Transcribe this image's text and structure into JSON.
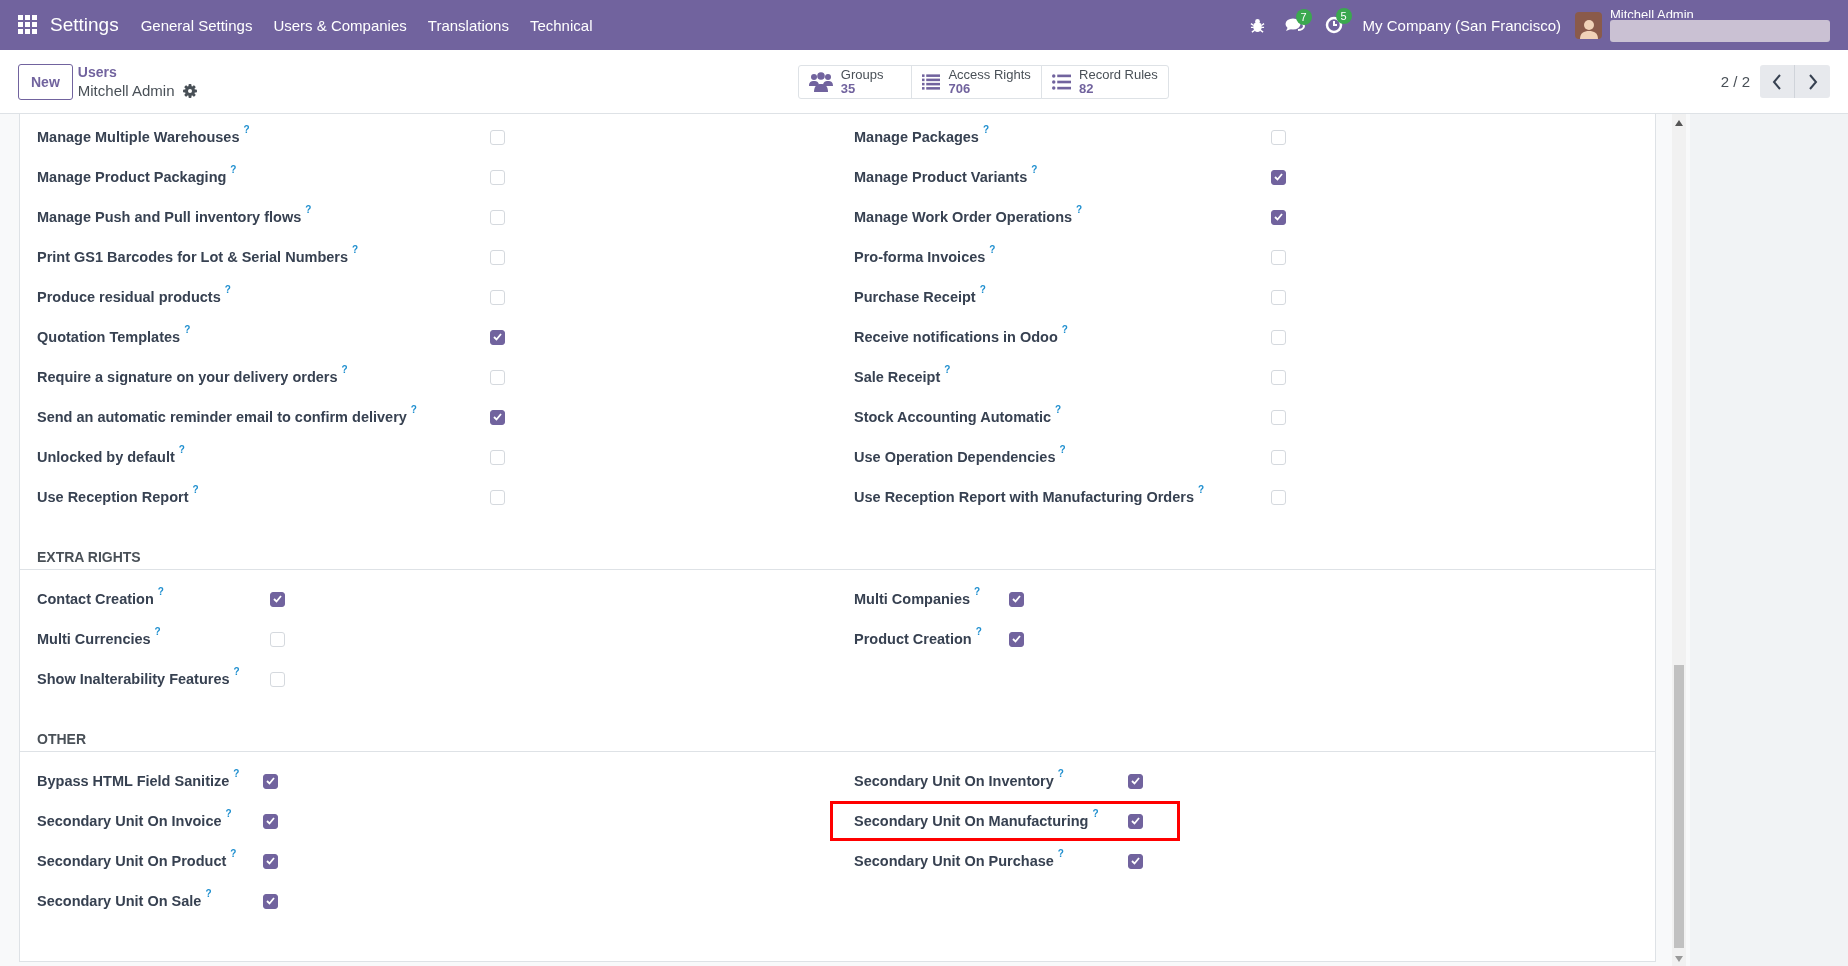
{
  "navbar": {
    "app_name": "Settings",
    "menu": [
      "General Settings",
      "Users & Companies",
      "Translations",
      "Technical"
    ],
    "messages_badge": "7",
    "activities_badge": "5",
    "company": "My Company (San Francisco)",
    "user_name": "Mitchell Admin"
  },
  "control_panel": {
    "new_button": "New",
    "breadcrumb": "Users",
    "record_title": "Mitchell Admin",
    "stat_buttons": [
      {
        "kind": "groups",
        "label": "Groups",
        "count": "35"
      },
      {
        "kind": "access",
        "label": "Access Rights",
        "count": "706"
      },
      {
        "kind": "rules",
        "label": "Record Rules",
        "count": "82"
      }
    ],
    "pager": "2 / 2"
  },
  "sections": [
    {
      "left": [
        {
          "label": "Manage Multiple Warehouses",
          "help": "?",
          "checked": false,
          "highlighted": false
        },
        {
          "label": "Manage Product Packaging",
          "help": "?",
          "checked": false,
          "highlighted": false
        },
        {
          "label": "Manage Push and Pull inventory flows",
          "help": "?",
          "checked": false,
          "highlighted": false
        },
        {
          "label": "Print GS1 Barcodes for Lot & Serial Numbers",
          "help": "?",
          "checked": false,
          "highlighted": false
        },
        {
          "label": "Produce residual products",
          "help": "?",
          "checked": false,
          "highlighted": false
        },
        {
          "label": "Quotation Templates",
          "help": "?",
          "checked": true,
          "highlighted": false
        },
        {
          "label": "Require a signature on your delivery orders",
          "help": "?",
          "checked": false,
          "highlighted": false
        },
        {
          "label": "Send an automatic reminder email to confirm delivery",
          "help": "?",
          "checked": true,
          "highlighted": false
        },
        {
          "label": "Unlocked by default",
          "help": "?",
          "checked": false,
          "highlighted": false
        },
        {
          "label": "Use Reception Report",
          "help": "?",
          "checked": false,
          "highlighted": false
        }
      ],
      "right": [
        {
          "label": "Manage Packages",
          "help": "?",
          "checked": false,
          "highlighted": false
        },
        {
          "label": "Manage Product Variants",
          "help": "?",
          "checked": true,
          "highlighted": false
        },
        {
          "label": "Manage Work Order Operations",
          "help": "?",
          "checked": true,
          "highlighted": false
        },
        {
          "label": "Pro-forma Invoices",
          "help": "?",
          "checked": false,
          "highlighted": false
        },
        {
          "label": "Purchase Receipt",
          "help": "?",
          "checked": false,
          "highlighted": false
        },
        {
          "label": "Receive notifications in Odoo",
          "help": "?",
          "checked": false,
          "highlighted": false
        },
        {
          "label": "Sale Receipt",
          "help": "?",
          "checked": false,
          "highlighted": false
        },
        {
          "label": "Stock Accounting Automatic",
          "help": "?",
          "checked": false,
          "highlighted": false
        },
        {
          "label": "Use Operation Dependencies",
          "help": "?",
          "checked": false,
          "highlighted": false
        },
        {
          "label": "Use Reception Report with Manufacturing Orders",
          "help": "?",
          "checked": false,
          "highlighted": false
        }
      ]
    },
    {
      "title": "EXTRA RIGHTS",
      "left": [
        {
          "label": "Contact Creation",
          "help": "?",
          "checked": true,
          "highlighted": false
        },
        {
          "label": "Multi Currencies",
          "help": "?",
          "checked": false,
          "highlighted": false
        },
        {
          "label": "Show Inalterability Features",
          "help": "?",
          "checked": false,
          "highlighted": false
        }
      ],
      "right": [
        {
          "label": "Multi Companies",
          "help": "?",
          "checked": true,
          "highlighted": false
        },
        {
          "label": "Product Creation",
          "help": "?",
          "checked": true,
          "highlighted": false
        }
      ]
    },
    {
      "title": "OTHER",
      "left": [
        {
          "label": "Bypass HTML Field Sanitize",
          "help": "?",
          "checked": true,
          "highlighted": false
        },
        {
          "label": "Secondary Unit On Invoice",
          "help": "?",
          "checked": true,
          "highlighted": false
        },
        {
          "label": "Secondary Unit On Product",
          "help": "?",
          "checked": true,
          "highlighted": false
        },
        {
          "label": "Secondary Unit On Sale",
          "help": "?",
          "checked": true,
          "highlighted": false
        }
      ],
      "right": [
        {
          "label": "Secondary Unit On Inventory",
          "help": "?",
          "checked": true,
          "highlighted": false
        },
        {
          "label": "Secondary Unit On Manufacturing",
          "help": "?",
          "checked": true,
          "highlighted": true
        },
        {
          "label": "Secondary Unit On Purchase",
          "help": "?",
          "checked": true,
          "highlighted": false
        }
      ]
    }
  ]
}
